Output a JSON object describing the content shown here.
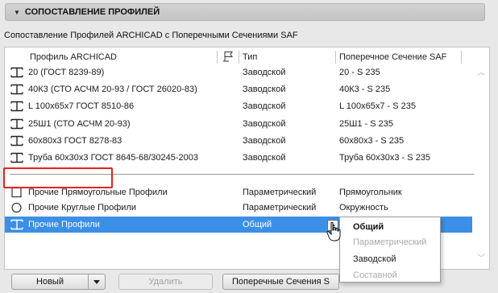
{
  "section": {
    "title": "СОПОСТАВЛЕНИЕ ПРОФИЛЕЙ",
    "arrow": "▼"
  },
  "subtitle": "Сопоставление Профилей ARCHICAD с Поперечными Сечениями SAF",
  "table": {
    "headers": {
      "profile": "Профиль ARCHICAD",
      "type": "Тип",
      "section": "Поперечное Сечение SAF"
    },
    "rows": [
      {
        "profile": "20 (ГОСТ 8239-89)",
        "type": "Заводской",
        "section": "20 - S 235",
        "icon": "i-beam-icon"
      },
      {
        "profile": "40К3 (СТО АСЧМ 20-93 / ГОСТ 26020-83)",
        "type": "Заводской",
        "section": "40К3 - S 235",
        "icon": "i-beam-icon"
      },
      {
        "profile": "L 100x65x7 ГОСТ 8510-86",
        "type": "Заводской",
        "section": "L 100x65x7 - S 235",
        "icon": "i-beam-icon"
      },
      {
        "profile": "25Ш1 (СТО АСЧМ 20-93)",
        "type": "Заводской",
        "section": "25Ш1 - S 235",
        "icon": "i-beam-icon"
      },
      {
        "profile": "60x80x3 ГОСТ 8278-83",
        "type": "Заводской",
        "section": "60x80x3 - S 235",
        "icon": "i-beam-icon"
      },
      {
        "profile": "Труба 60x30x3 ГОСТ 8645-68/30245-2003",
        "type": "Заводской",
        "section": "Труба 60x30x3 - S 235",
        "icon": "i-beam-icon"
      }
    ],
    "generic_rows": [
      {
        "profile": "Прочие Прямоугольные Профили",
        "type": "Параметрический",
        "section": "Прямоугольник",
        "icon": "rectangle-icon"
      },
      {
        "profile": "Прочие Круглые Профили",
        "type": "Параметрический",
        "section": "Окружность",
        "icon": "circle-icon"
      },
      {
        "profile": "Прочие Профили",
        "type": "Общий",
        "section": "",
        "icon": "i-beam-icon",
        "selected": true
      }
    ]
  },
  "popup_menu": {
    "items": [
      {
        "label": "Общий",
        "state": "current"
      },
      {
        "label": "Параметрический",
        "state": "disabled"
      },
      {
        "label": "Заводской",
        "state": "enabled"
      },
      {
        "label": "Составной",
        "state": "disabled"
      }
    ]
  },
  "buttons": {
    "new": "Новый",
    "delete": "Удалить",
    "cross_sections": "Поперечные Сечения S"
  },
  "colors": {
    "selection": "#3c8fe6",
    "highlight_border": "#e0231f"
  }
}
